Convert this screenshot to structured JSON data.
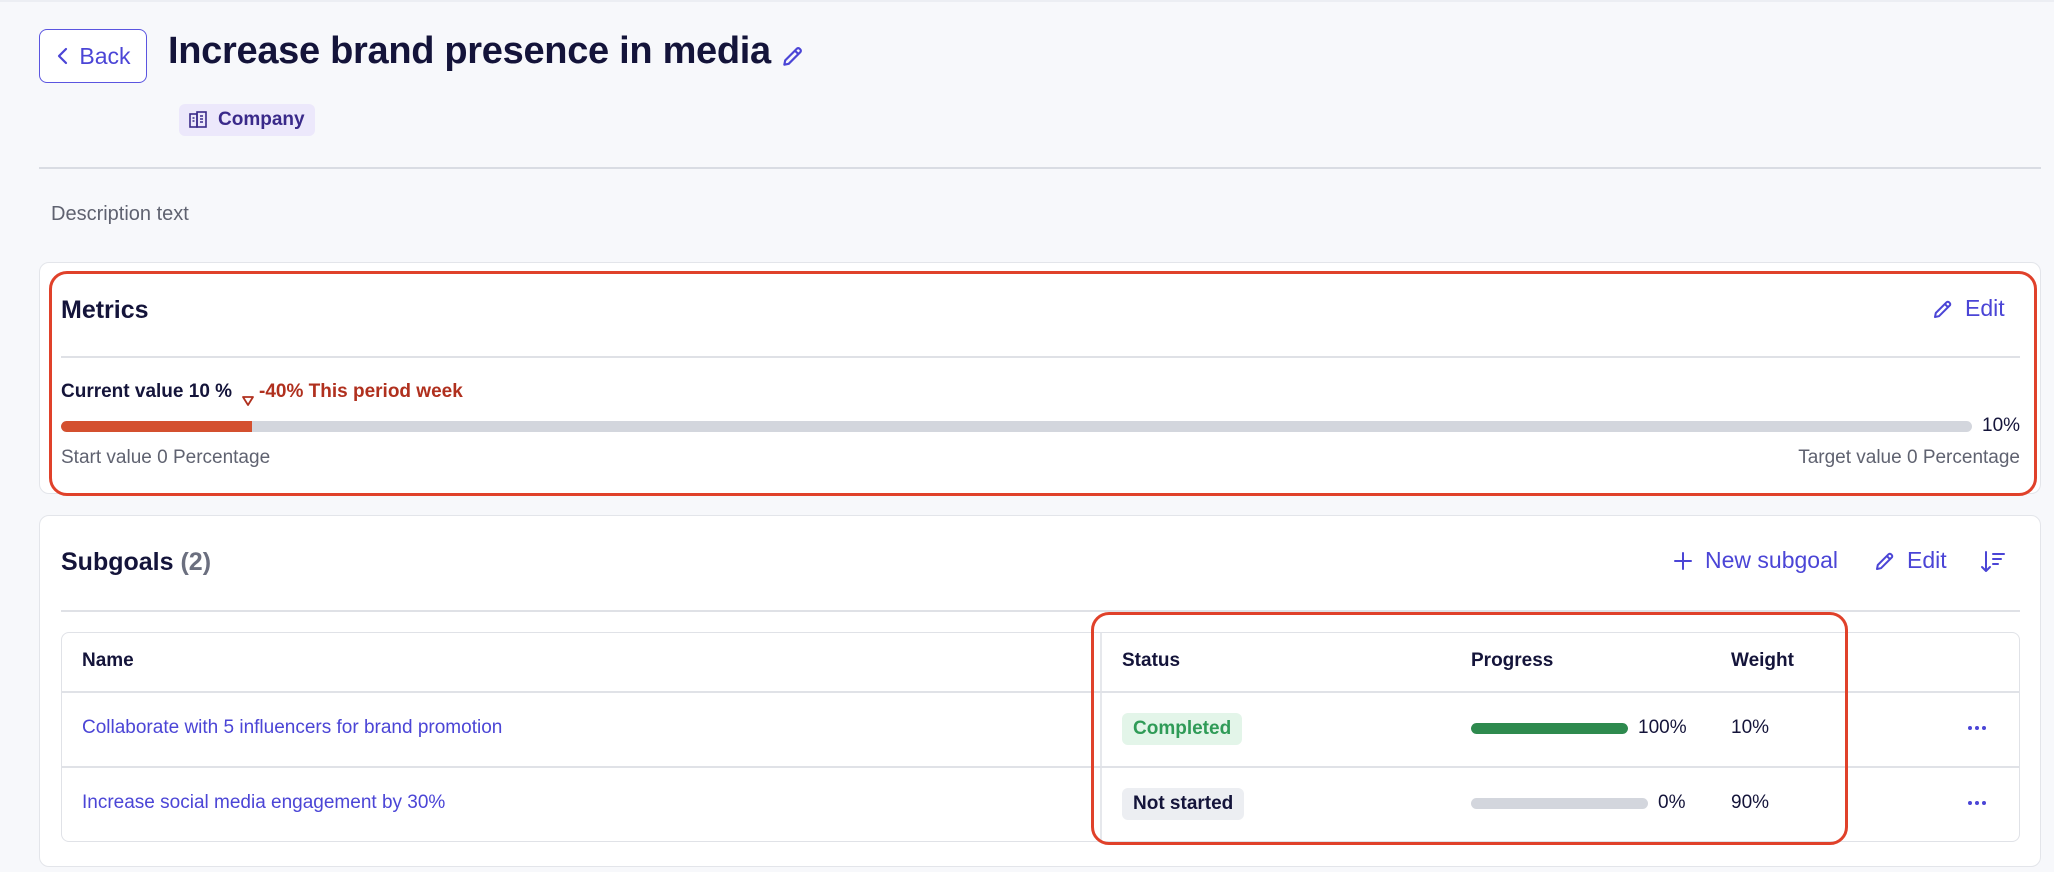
{
  "header": {
    "back_label": "Back",
    "title": "Increase brand presence in media",
    "scope_badge": "Company",
    "description": "Description text"
  },
  "metrics": {
    "title": "Metrics",
    "edit_label": "Edit",
    "current_value_label": "Current value 10 %",
    "change_label": "-40% This period week",
    "progress_fraction": 0.1,
    "progress_percent_label": "10%",
    "start_label": "Start value 0 Percentage",
    "target_label": "Target value 0 Percentage"
  },
  "subgoals": {
    "title": "Subgoals",
    "count_label": "(2)",
    "new_subgoal_label": "New subgoal",
    "edit_label": "Edit",
    "columns": {
      "name": "Name",
      "status": "Status",
      "progress": "Progress",
      "weight": "Weight"
    },
    "rows": [
      {
        "name": "Collaborate with 5 influencers for brand promotion",
        "status": "Completed",
        "progress_fraction": 1.0,
        "progress_label": "100%",
        "weight": "10%"
      },
      {
        "name": "Increase social media engagement by 30%",
        "status": "Not started",
        "progress_fraction": 0.0,
        "progress_label": "0%",
        "weight": "90%"
      }
    ]
  },
  "colors": {
    "accent": "#4b45d6",
    "metric_bar": "#d4502f",
    "negative_change": "#b0301e",
    "completed_green": "#2f9b57",
    "highlight_red": "#e0412a"
  },
  "icons": {
    "back": "chevron-left-icon",
    "title_edit": "pencil-icon",
    "badge": "building-icon",
    "change": "triangle-down-icon",
    "new_subgoal": "plus-icon",
    "sort": "sort-icon",
    "row_menu": "ellipsis-icon"
  }
}
